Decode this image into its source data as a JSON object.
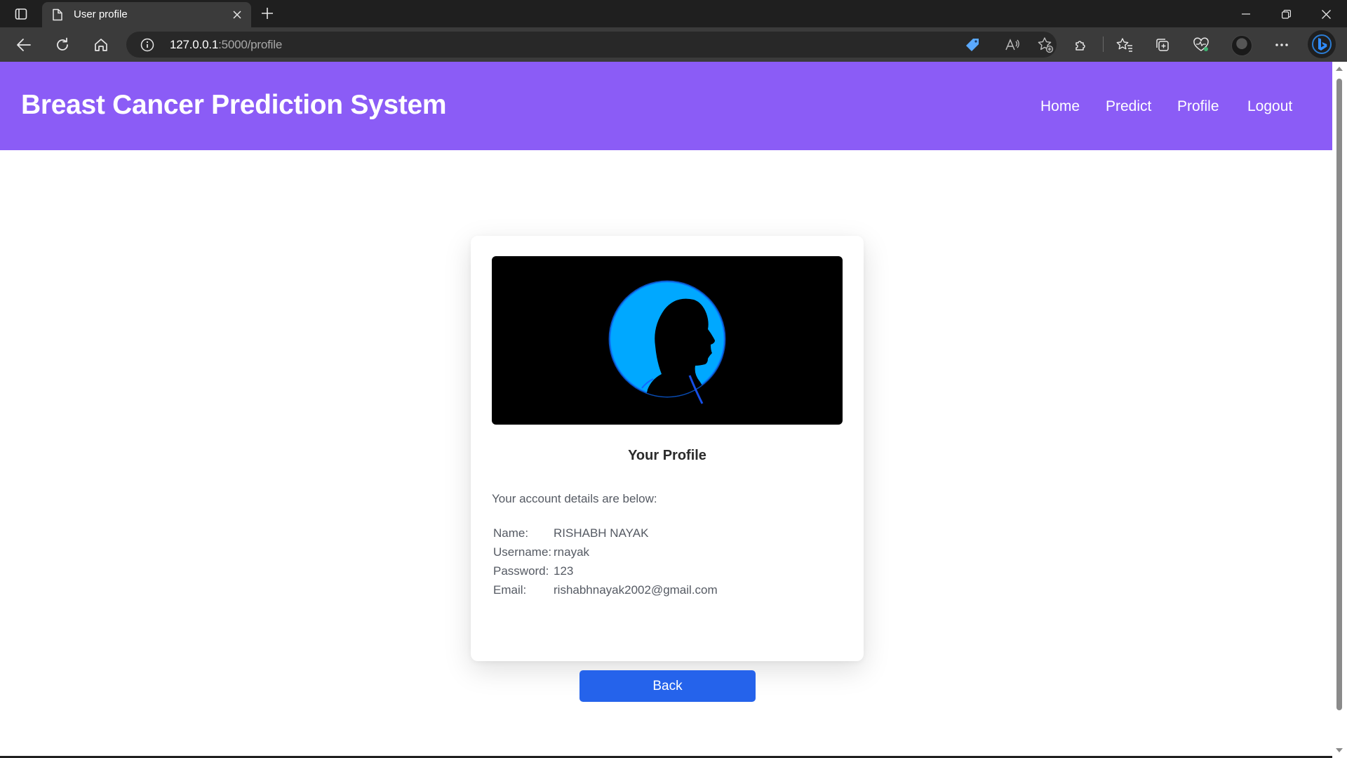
{
  "browser": {
    "tab_title": "User profile",
    "url_host": "127.0.0.1",
    "url_path": ":5000/profile"
  },
  "site": {
    "title": "Breast Cancer Prediction System",
    "nav": [
      "Home",
      "Predict",
      "Profile",
      "Logout"
    ],
    "accent_color": "#8b5cf6"
  },
  "profile": {
    "heading": "Your Profile",
    "intro": "Your account details are below:",
    "fields": [
      {
        "label": "Name:",
        "value": "RISHABH NAYAK"
      },
      {
        "label": "Username:",
        "value": "rnayak"
      },
      {
        "label": "Password:",
        "value": "123"
      },
      {
        "label": "Email:",
        "value": "rishabhnayak2002@gmail.com"
      }
    ],
    "back_label": "Back",
    "button_color": "#2563eb",
    "image_icon": "person-silhouette-icon"
  }
}
